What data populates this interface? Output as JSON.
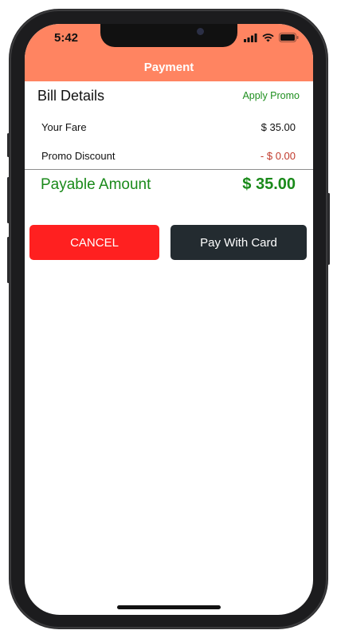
{
  "status_bar": {
    "time": "5:42"
  },
  "header": {
    "title": "Payment",
    "background": "#ff8461"
  },
  "bill": {
    "heading": "Bill Details",
    "apply_promo": "Apply Promo",
    "rows": [
      {
        "label": "Your Fare",
        "value": "$ 35.00"
      },
      {
        "label": "Promo Discount",
        "value": "- $ 0.00"
      }
    ],
    "payable": {
      "label": "Payable Amount",
      "value": "$ 35.00"
    }
  },
  "buttons": {
    "cancel": "CANCEL",
    "pay": "Pay With Card"
  },
  "colors": {
    "accent_green": "#1a8a1a",
    "cancel_red": "#ff2020",
    "pay_dark": "#232b30",
    "discount_red": "#c0392b"
  },
  "icons": [
    "signal-icon",
    "wifi-icon",
    "battery-icon"
  ]
}
